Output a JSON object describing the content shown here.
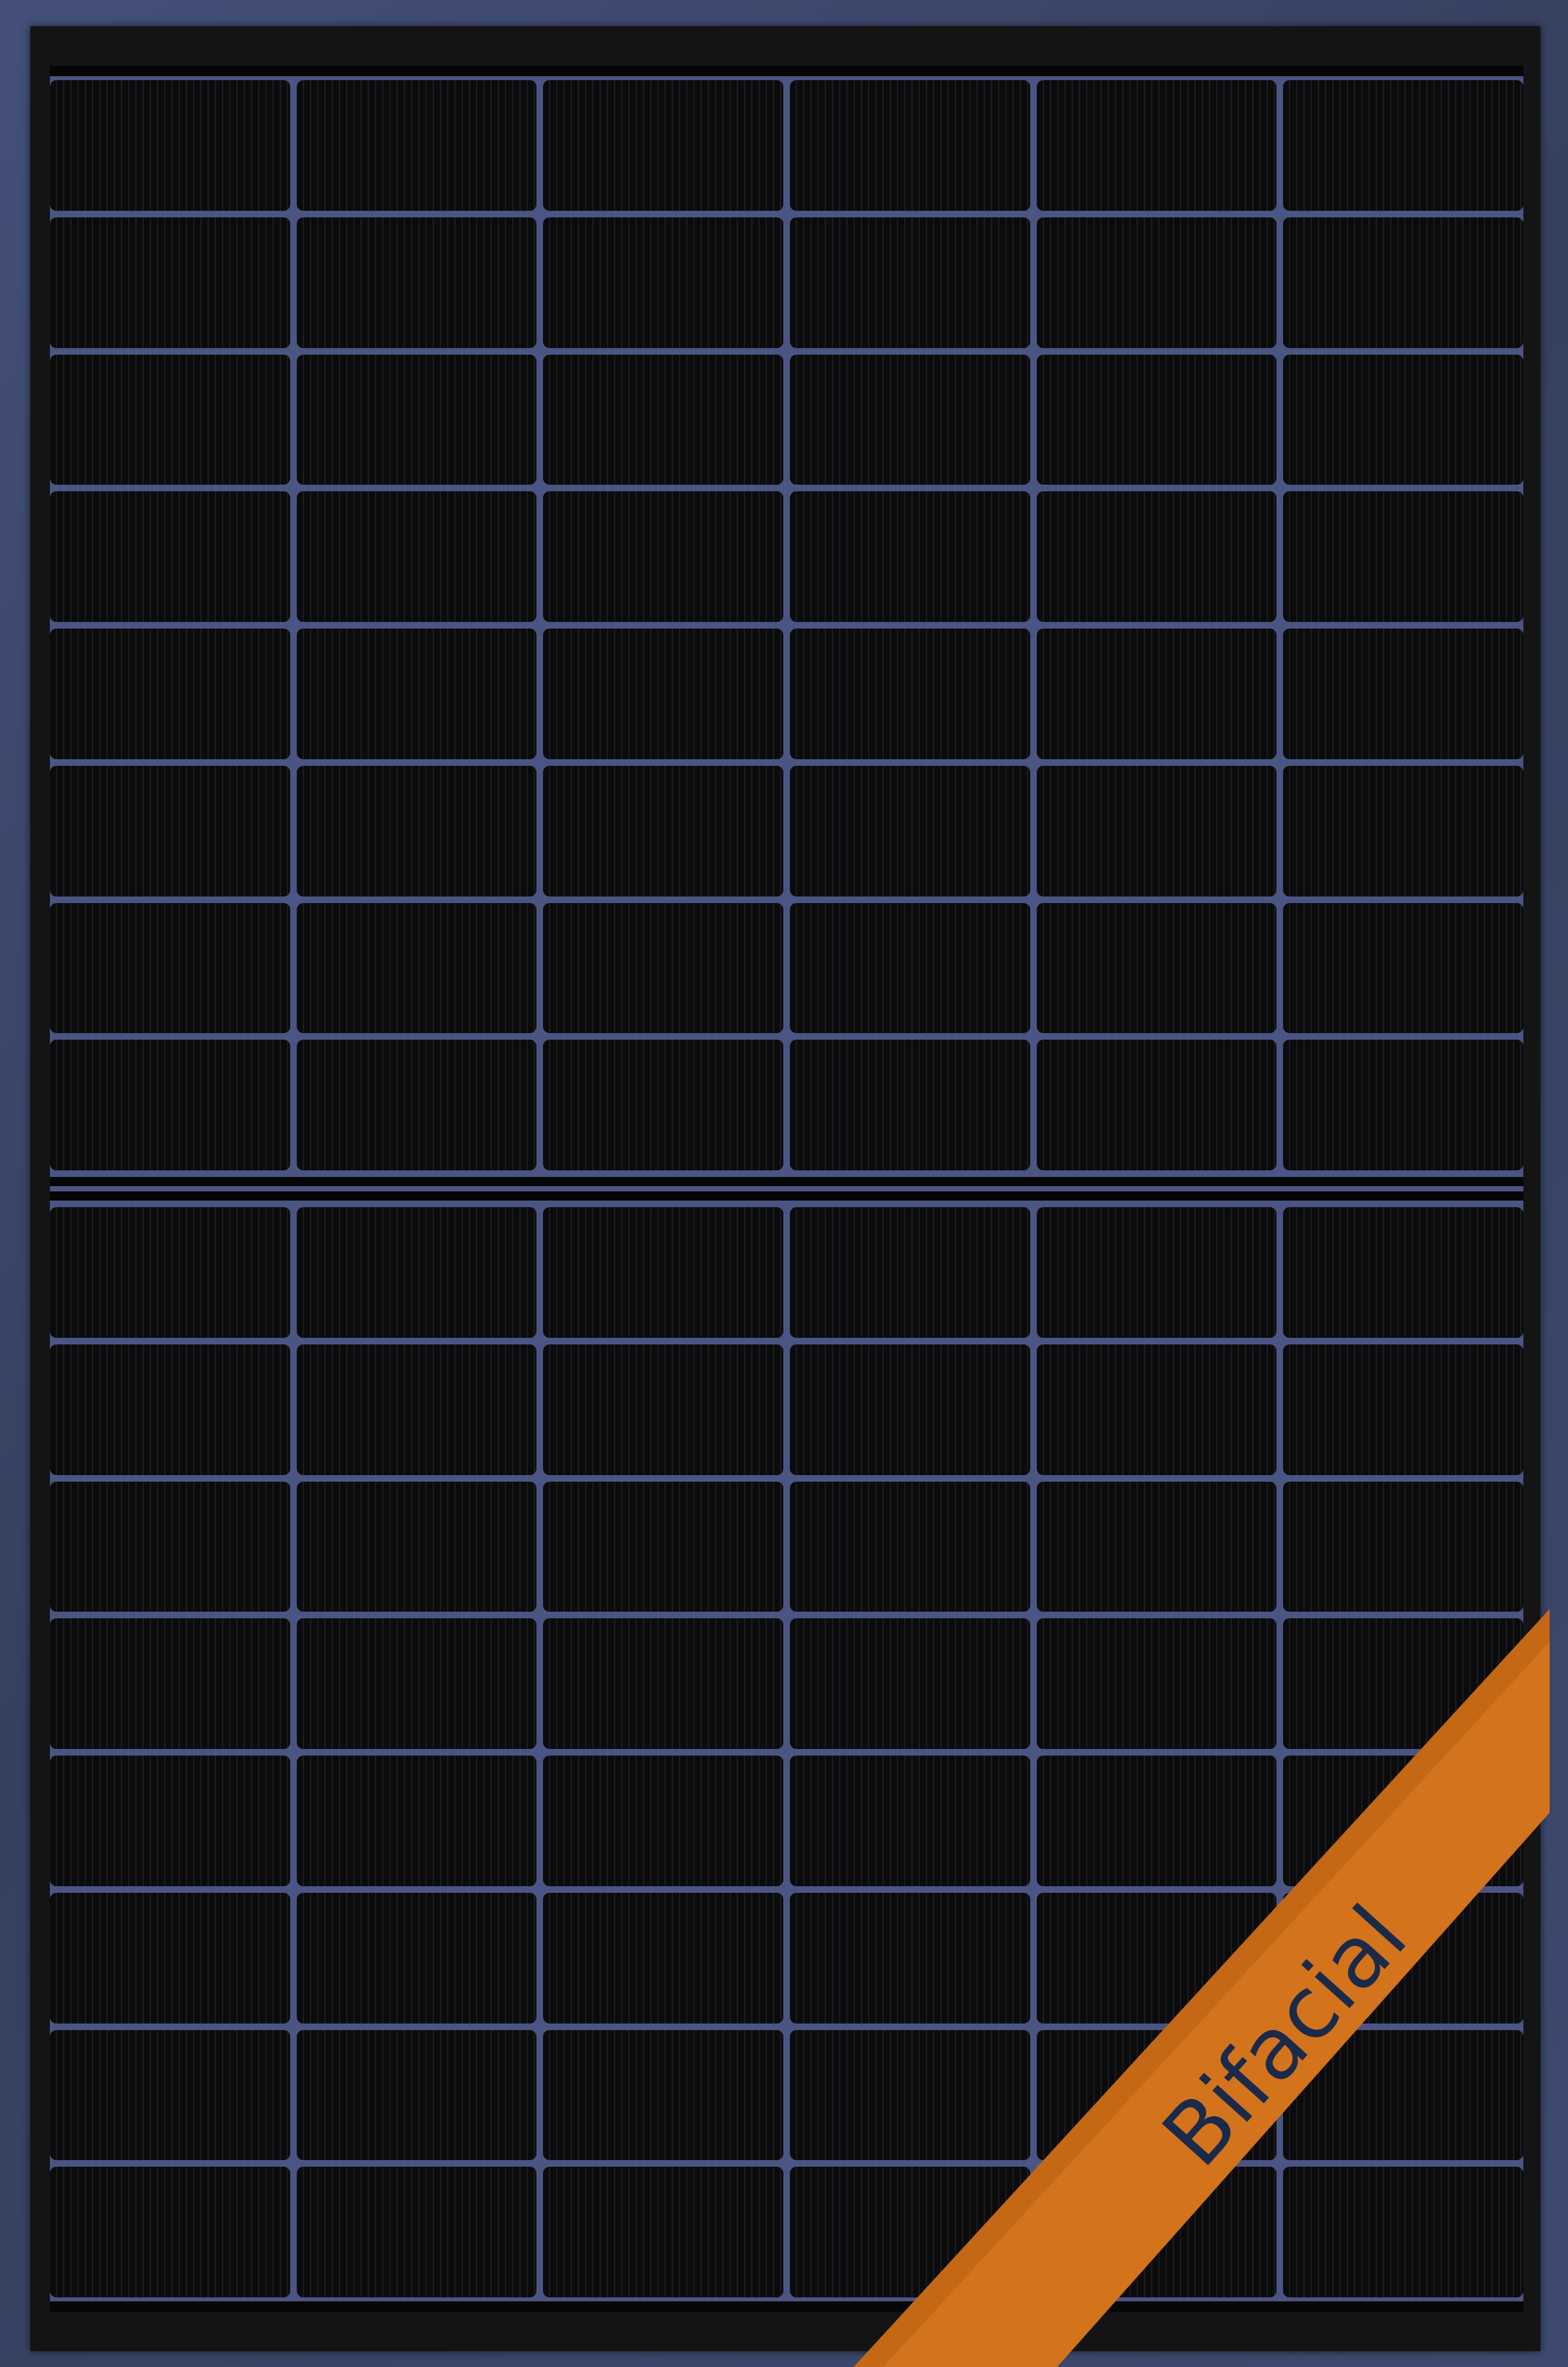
{
  "banner": {
    "label": "Bifacial",
    "color": "#d3731c",
    "text_color": "#1a2a4a"
  },
  "colors": {
    "background": "#3b4668",
    "frame": "#141414",
    "cell": "#0c0c0c",
    "cell_gap": "#4b5584"
  }
}
